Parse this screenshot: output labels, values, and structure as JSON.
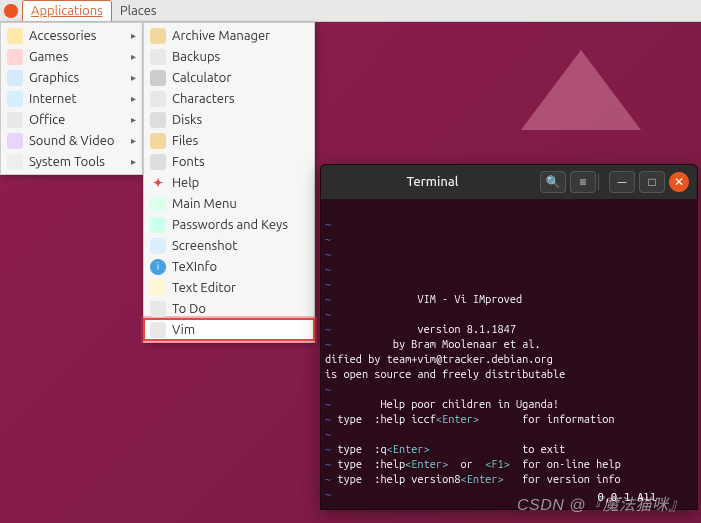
{
  "topbar": {
    "applications": "Applications",
    "places": "Places"
  },
  "categories": [
    {
      "label": "Accessories",
      "icon": "i-acc"
    },
    {
      "label": "Games",
      "icon": "i-game"
    },
    {
      "label": "Graphics",
      "icon": "i-gfx"
    },
    {
      "label": "Internet",
      "icon": "i-net"
    },
    {
      "label": "Office",
      "icon": "i-off"
    },
    {
      "label": "Sound & Video",
      "icon": "i-snd"
    },
    {
      "label": "System Tools",
      "icon": "i-sys"
    }
  ],
  "accessories": [
    {
      "label": "Archive Manager",
      "icon": "i-archive"
    },
    {
      "label": "Backups",
      "icon": "i-bak"
    },
    {
      "label": "Calculator",
      "icon": "i-calc"
    },
    {
      "label": "Characters",
      "icon": "i-char"
    },
    {
      "label": "Disks",
      "icon": "i-disk"
    },
    {
      "label": "Files",
      "icon": "i-files"
    },
    {
      "label": "Fonts",
      "icon": "i-fonts"
    },
    {
      "label": "Help",
      "icon": "i-help",
      "glyph": "✦"
    },
    {
      "label": "Main Menu",
      "icon": "i-mainmenu"
    },
    {
      "label": "Passwords and Keys",
      "icon": "i-pwd"
    },
    {
      "label": "Screenshot",
      "icon": "i-sshot"
    },
    {
      "label": "TeXInfo",
      "icon": "i-tex",
      "glyph": "i"
    },
    {
      "label": "Text Editor",
      "icon": "i-txt"
    },
    {
      "label": "To Do",
      "icon": "i-todo"
    },
    {
      "label": "Vim",
      "icon": "i-vim",
      "highlight": true
    }
  ],
  "terminal": {
    "title": "Terminal",
    "lines": {
      "l1": "VIM - Vi IMproved",
      "l2": "version 8.1.1847",
      "l3": "by Bram Moolenaar et al.",
      "l4": "dified by team+vim@tracker.debian.org",
      "l5": "is open source and freely distributable",
      "l6": "Help poor children in Uganda!",
      "l7a": "type  :help iccf",
      "l7b": "<Enter>",
      "l7c": "       for information",
      "l8a": "type  :q",
      "l8b": "<Enter>",
      "l8c": "               to exit",
      "l9a": "type  :help",
      "l9b": "<Enter>",
      "l9c": "  or  ",
      "l9d": "<F1>",
      "l9e": "  for on-line help",
      "l10a": "type  :help version8",
      "l10b": "<Enter>",
      "l10c": "   for version info"
    },
    "status": "0,0-1         All"
  },
  "watermark": "CSDN @『魔法猫咪』"
}
